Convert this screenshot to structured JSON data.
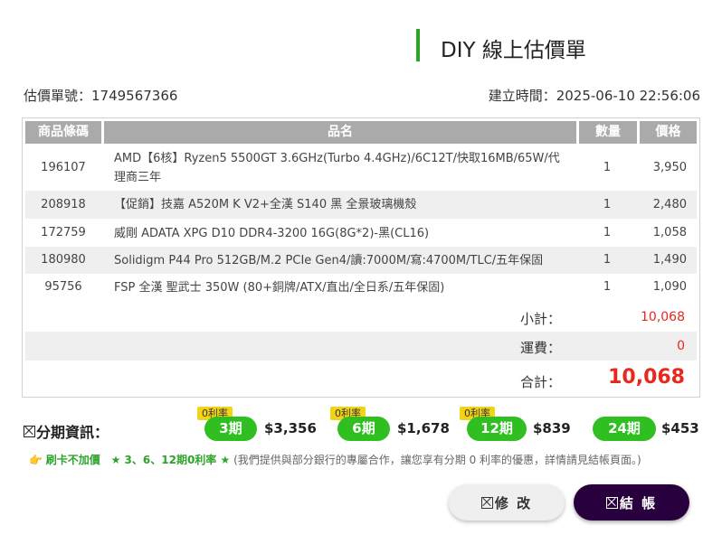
{
  "header": {
    "title": "DIY 線上估價單",
    "quote_no": "估價單號：1749567366",
    "created": "建立時間：2025-06-10 22:56:06"
  },
  "table": {
    "headers": [
      "商品條碼",
      "品名",
      "數量",
      "價格"
    ],
    "rows": [
      {
        "code": "196107",
        "name": "AMD【6核】Ryzen5 5500GT 3.6GHz(Turbo 4.4GHz)/6C12T/快取16MB/65W/代理商三年",
        "qty": "1",
        "price": "3,950"
      },
      {
        "code": "208918",
        "name": "【促銷】技嘉 A520M K V2+全漢 S140 黑 全景玻璃機殼",
        "qty": "1",
        "price": "2,480"
      },
      {
        "code": "172759",
        "name": "威剛 ADATA XPG D10 DDR4-3200 16G(8G*2)-黑(CL16)",
        "qty": "1",
        "price": "1,058"
      },
      {
        "code": "180980",
        "name": "Solidigm P44 Pro 512GB/M.2 PCIe Gen4/讀:7000M/寫:4700M/TLC/五年保固",
        "qty": "1",
        "price": "1,490"
      },
      {
        "code": "95756",
        "name": "FSP 全漢 聖武士 350W (80+銅牌/ATX/直出/全日系/五年保固)",
        "qty": "1",
        "price": "1,090"
      }
    ]
  },
  "summary": {
    "subtotal_label": "小計：",
    "subtotal": "10,068",
    "shipping_label": "運費：",
    "shipping": "0",
    "total_label": "合計：",
    "total": "10,068"
  },
  "installments": {
    "title": "分期資訊：",
    "zero_label": "0利率",
    "plans": [
      {
        "period": "3期",
        "amount": "$3,356",
        "zero": true
      },
      {
        "period": "6期",
        "amount": "$1,678",
        "zero": true
      },
      {
        "period": "12期",
        "amount": "$839",
        "zero": true
      },
      {
        "period": "24期",
        "amount": "$453",
        "zero": false
      }
    ]
  },
  "promo": {
    "hand_icon": "pointing-hand-icon",
    "no_surcharge": "刷卡不加價",
    "zero_rate": "★ 3、6、12期0利率 ★",
    "note": "(我們提供與部分銀行的專屬合作，讓您享有分期 0 利率的優惠，詳情請見結帳頁面。)"
  },
  "buttons": {
    "edit": "修 改",
    "checkout": "結 帳"
  },
  "colors": {
    "accent_green": "#2ea42b",
    "price_red": "#e8281c",
    "checkout_bg": "#28003d",
    "zero_tag": "#f3d318"
  }
}
